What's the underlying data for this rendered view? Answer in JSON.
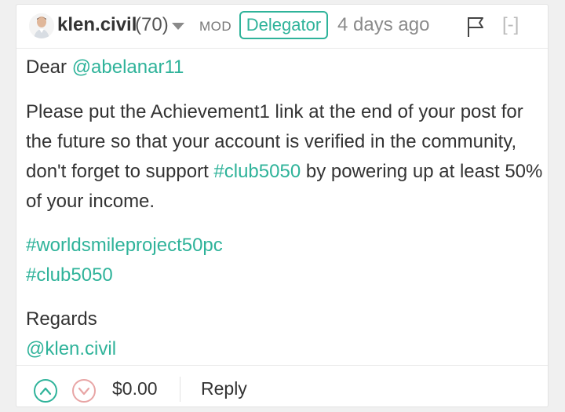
{
  "comment": {
    "author": "klen.civil",
    "reputation": "(70)",
    "role": "MOD",
    "badge": "Delegator",
    "timestamp": "4 days ago",
    "collapse": "[-]",
    "greeting_prefix": "Dear ",
    "greeting_mention": "@abelanar11",
    "para1_line1": "Please put the Achievement1 link at the end of your post for",
    "para1_line2": "the future so that your account is verified in the community,",
    "para1_line3_a": "don't forget to support ",
    "para1_line3_tag": "#club5050",
    "para1_line3_b": " by powering up at least 50%",
    "para1_line4": "of your income.",
    "tag1": "#worldsmileproject50pc",
    "tag2": "#club5050",
    "signoff": "Regards",
    "signature": "@klen.civil",
    "payout": "$0.00",
    "reply_label": "Reply"
  },
  "colors": {
    "accent": "#2fb39a",
    "downvote": "#e8a5a5",
    "muted": "#8a8a8a"
  },
  "icons": {
    "avatar": "avatar",
    "dropdown": "caret-down-icon",
    "flag": "flag-icon",
    "upvote": "chevron-up-icon",
    "downvote": "chevron-down-icon"
  }
}
